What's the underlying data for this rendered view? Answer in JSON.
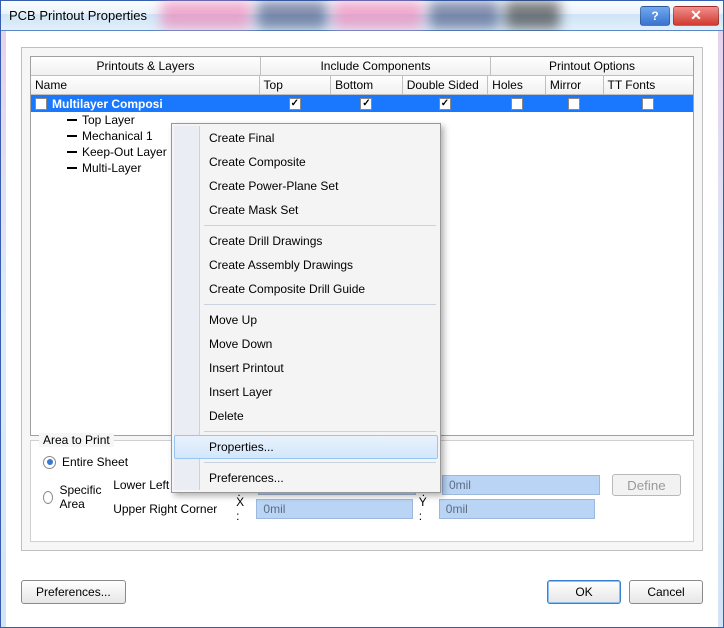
{
  "window": {
    "title": "PCB Printout Properties"
  },
  "grid": {
    "group_headers": {
      "name": "Printouts & Layers",
      "include": "Include Components",
      "options": "Printout Options"
    },
    "columns": {
      "name": "Name",
      "top": "Top",
      "bottom": "Bottom",
      "double": "Double Sided",
      "holes": "Holes",
      "mirror": "Mirror",
      "tt": "TT Fonts"
    },
    "row": {
      "name": "Multilayer Composi",
      "top_checked": true,
      "bottom_checked": true,
      "double_checked": true,
      "holes_checked": false,
      "mirror_checked": false,
      "tt_checked": false
    },
    "children": [
      {
        "label": "Top Layer"
      },
      {
        "label": "Mechanical 1"
      },
      {
        "label": "Keep-Out Layer"
      },
      {
        "label": "Multi-Layer"
      }
    ]
  },
  "context_menu": {
    "items": [
      {
        "label": "Create Final"
      },
      {
        "label": "Create Composite"
      },
      {
        "label": "Create Power-Plane Set"
      },
      {
        "label": "Create Mask Set"
      }
    ],
    "items2": [
      {
        "label": "Create Drill Drawings"
      },
      {
        "label": "Create Assembly Drawings"
      },
      {
        "label": "Create Composite Drill Guide"
      }
    ],
    "items3": [
      {
        "label": "Move Up"
      },
      {
        "label": "Move Down"
      },
      {
        "label": "Insert Printout"
      },
      {
        "label": "Insert Layer"
      },
      {
        "label": "Delete"
      }
    ],
    "items4": [
      {
        "label": "Properties...",
        "highlight": true
      }
    ],
    "items5": [
      {
        "label": "Preferences..."
      }
    ]
  },
  "area": {
    "title": "Area to Print",
    "entire": "Entire Sheet",
    "specific": "Specific Area",
    "lower_left": "Lower Left Corner",
    "upper_right": "Upper Right Corner",
    "x": "X :",
    "y": "Y :",
    "val": "0mil",
    "define": "Define"
  },
  "buttons": {
    "prefs": "Preferences...",
    "ok": "OK",
    "cancel": "Cancel"
  }
}
